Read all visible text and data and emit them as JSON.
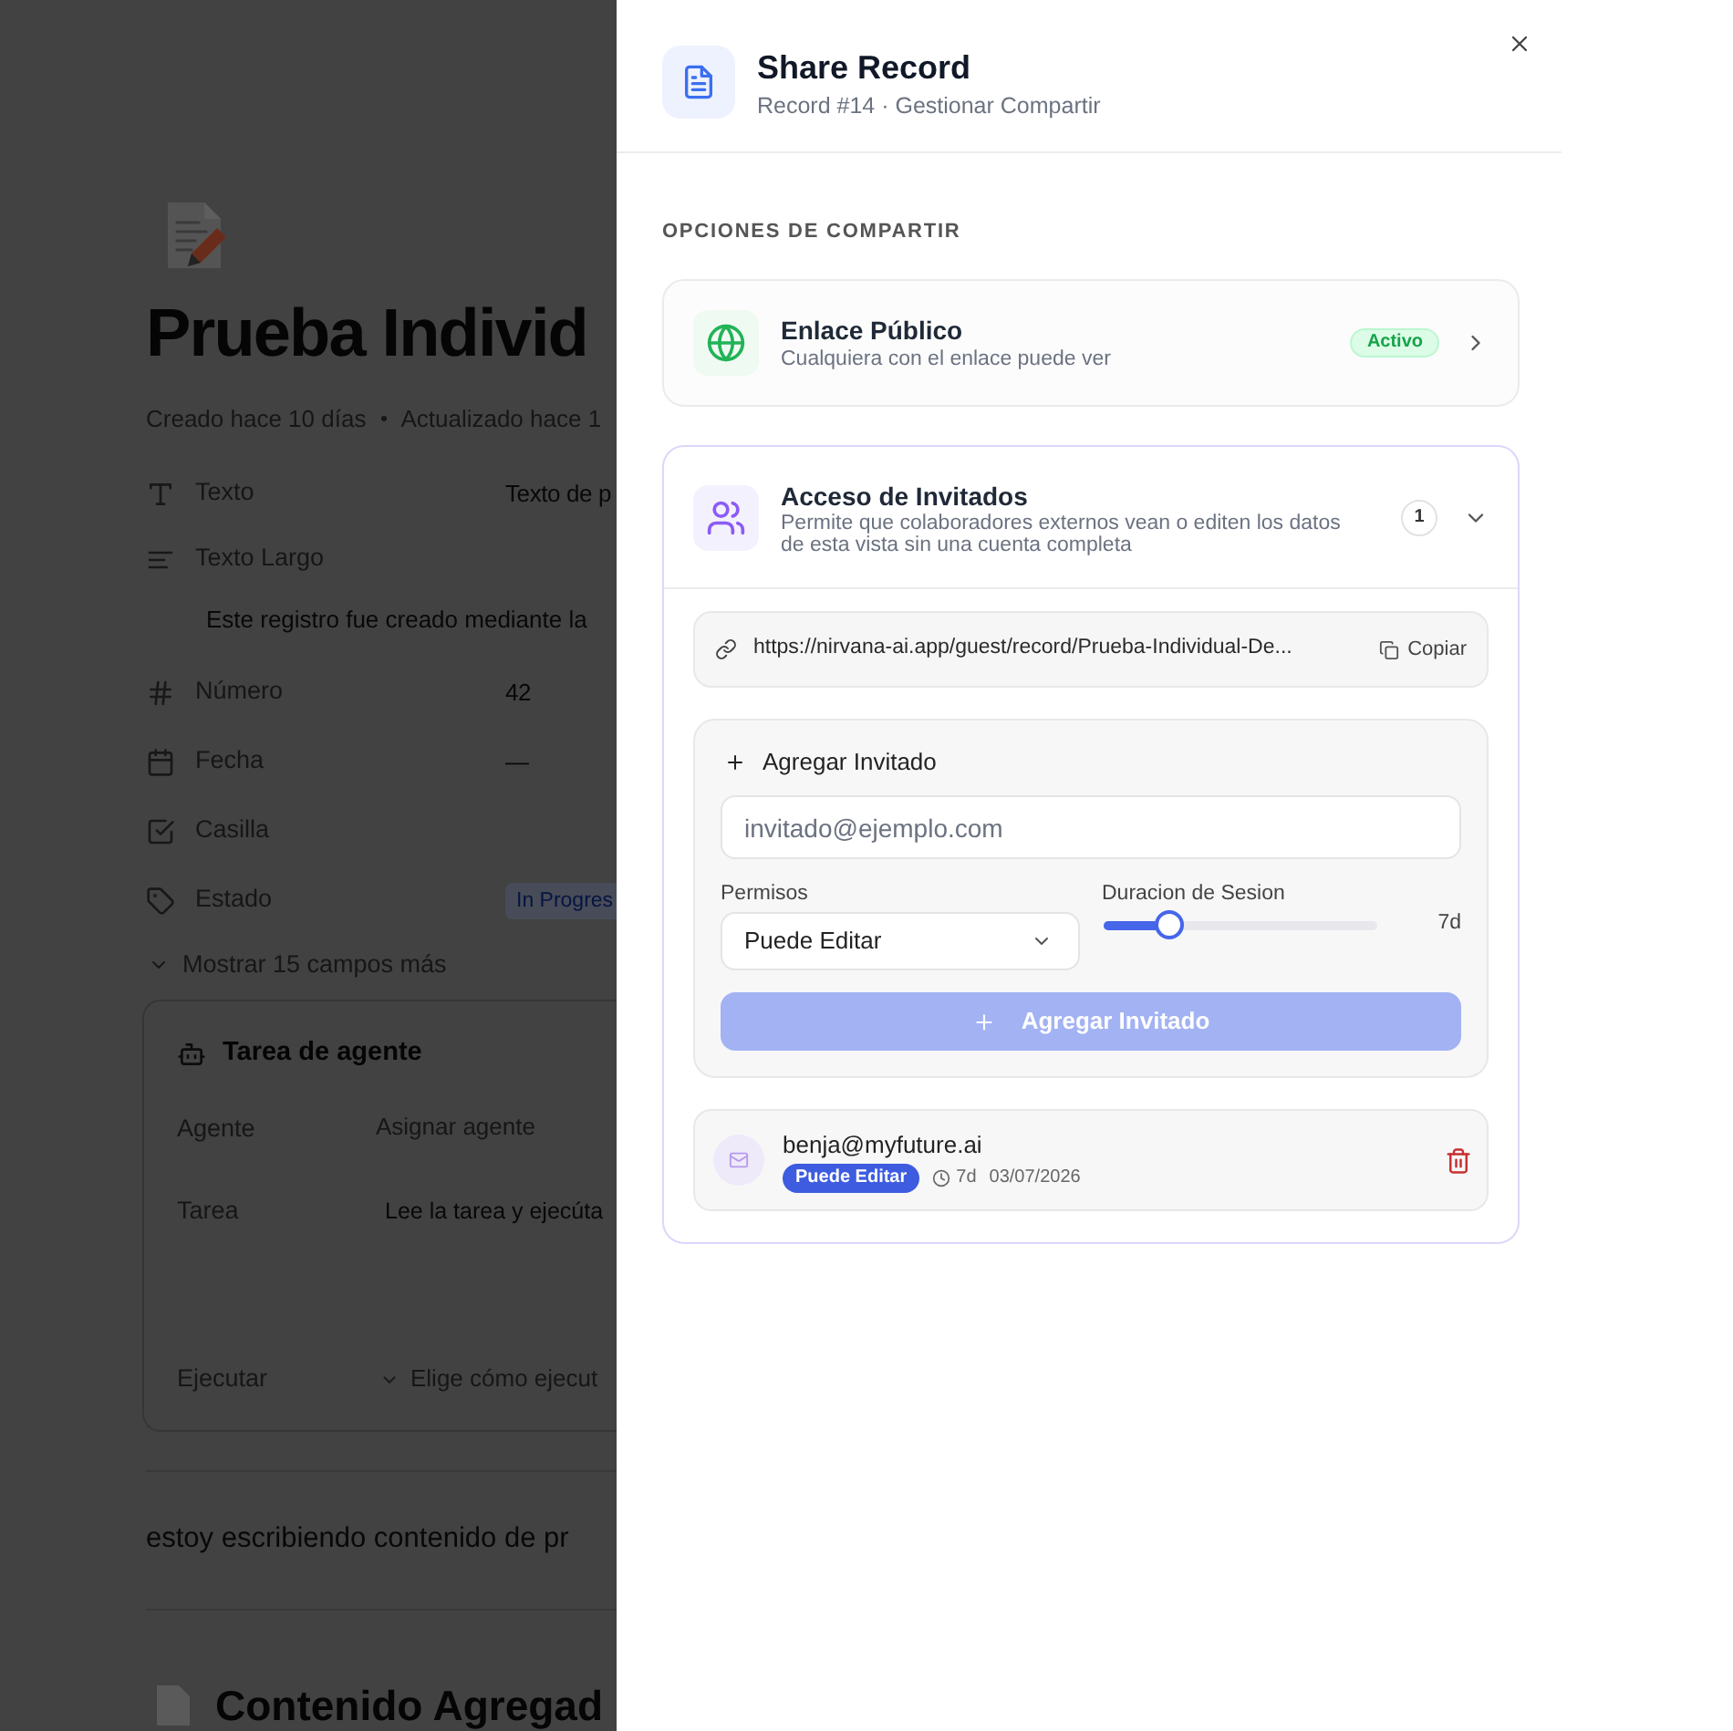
{
  "background_page": {
    "title": "Prueba Individ",
    "meta": [
      "Creado hace 10 días",
      "Actualizado hace 1"
    ],
    "properties": [
      {
        "kind": "text",
        "label": "Texto",
        "value": "Texto de p"
      },
      {
        "kind": "long_text",
        "label": "Texto Largo",
        "value": "Este registro fue creado mediante la"
      },
      {
        "kind": "number",
        "label": "Número",
        "value": "42"
      },
      {
        "kind": "date",
        "label": "Fecha",
        "value": "—"
      },
      {
        "kind": "checkbox",
        "label": "Casilla"
      },
      {
        "kind": "status",
        "label": "Estado",
        "value": "In Progres"
      }
    ],
    "show_more": "Mostrar 15 campos más",
    "agent_task": {
      "title": "Tarea de agente",
      "fields": [
        {
          "kind": "select",
          "label": "Agente",
          "placeholder": "Asignar agente"
        },
        {
          "kind": "textarea",
          "label": "Tarea",
          "value": "Lee la tarea y ejecúta"
        },
        {
          "kind": "dropdown",
          "label": "Ejecutar",
          "placeholder": "Elige cómo ejecut"
        }
      ]
    },
    "paragraph": "estoy escribiendo contenido de pr",
    "heading": "Contenido Agregad"
  },
  "share_panel": {
    "title": "Share Record",
    "subtitle": "Record #14 · Gestionar Compartir",
    "section_label": "OPCIONES DE COMPARTIR",
    "options": [
      {
        "kind": "public_link",
        "title": "Enlace Público",
        "description": "Cualquiera con el enlace puede ver",
        "badge": "Activo",
        "expanded": false
      },
      {
        "kind": "guest_access",
        "title": "Acceso de Invitados",
        "description": "Permite que colaboradores externos vean o editen los datos de esta vista sin una cuenta completa",
        "count": "1",
        "expanded": true,
        "link": {
          "url": "https://nirvana-ai.app/guest/record/Prueba-Individual-De...",
          "copy_label": "Copiar"
        },
        "add_guest": {
          "heading": "Agregar Invitado",
          "email_placeholder": "invitado@ejemplo.com",
          "permissions_label": "Permisos",
          "permission_value": "Puede Editar",
          "duration_label": "Duracion de Sesion",
          "duration_slider": {
            "level": 0.24
          },
          "duration_reading": "7d",
          "submit_label": "Agregar Invitado",
          "submit_disabled": true
        },
        "guests": [
          {
            "email": "benja@myfuture.ai",
            "permission": "Puede Editar",
            "duration": "7d",
            "expires": "03/07/2026"
          }
        ]
      }
    ]
  }
}
